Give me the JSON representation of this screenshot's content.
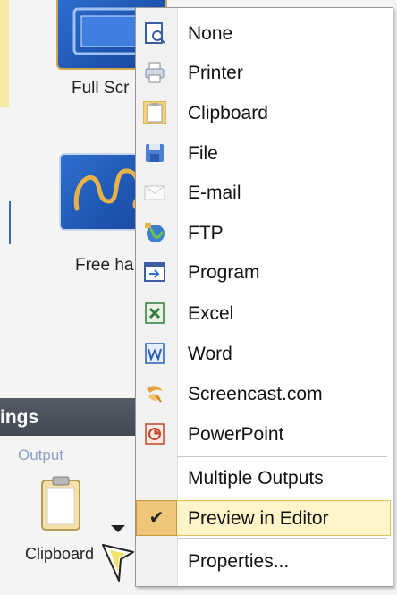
{
  "ribbon": {
    "full_screen_caption": "Full Scr",
    "free_hand_caption": "Free ha",
    "group_label": "ings",
    "output_label": "Output",
    "clipboard_button_label": "Clipboard"
  },
  "menu": {
    "items": [
      {
        "label": "None",
        "icon": "none-icon"
      },
      {
        "label": "Printer",
        "icon": "printer-icon"
      },
      {
        "label": "Clipboard",
        "icon": "clipboard-icon"
      },
      {
        "label": "File",
        "icon": "file-icon"
      },
      {
        "label": "E-mail",
        "icon": "email-icon"
      },
      {
        "label": "FTP",
        "icon": "ftp-icon"
      },
      {
        "label": "Program",
        "icon": "program-icon"
      },
      {
        "label": "Excel",
        "icon": "excel-icon"
      },
      {
        "label": "Word",
        "icon": "word-icon"
      },
      {
        "label": "Screencast.com",
        "icon": "screencast-icon"
      },
      {
        "label": "PowerPoint",
        "icon": "powerpoint-icon"
      }
    ],
    "multiple_outputs": "Multiple Outputs",
    "preview_in_editor": {
      "label": "Preview in Editor",
      "checked": true
    },
    "properties": "Properties..."
  },
  "colors": {
    "thumbnail_blue": "#2d6fd0",
    "thumbnail_selected_border": "#d4a451",
    "checked_highlight": "#fff5c8",
    "check_square": "#eec67a",
    "group_band": "#4b515d"
  }
}
